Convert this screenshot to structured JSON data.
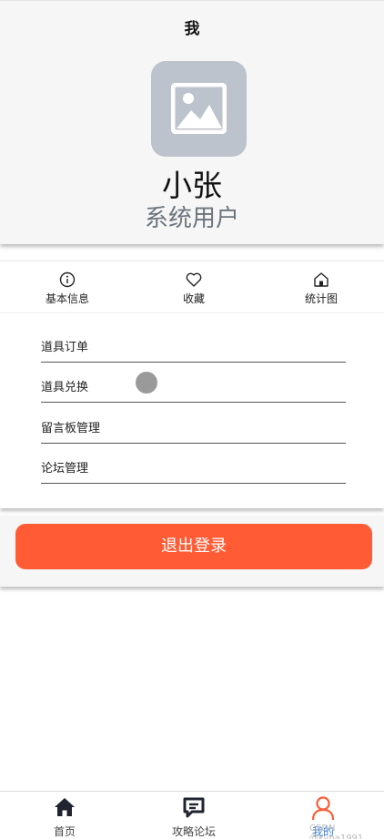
{
  "header": {
    "title": "我",
    "avatar_icon": "image-placeholder-icon",
    "user_name": "小张",
    "user_role": "系统用户"
  },
  "quick_links": [
    {
      "label": "基本信息",
      "icon": "info-circle-icon"
    },
    {
      "label": "收藏",
      "icon": "heart-icon"
    },
    {
      "label": "统计图",
      "icon": "home-icon"
    }
  ],
  "menu": [
    {
      "label": "道具订单"
    },
    {
      "label": "道具兑换"
    },
    {
      "label": "留言板管理"
    },
    {
      "label": "论坛管理"
    }
  ],
  "logout_label": "退出登录",
  "tabbar": [
    {
      "label": "首页",
      "icon": "home-filled-icon",
      "active": false
    },
    {
      "label": "攻略论坛",
      "icon": "chat-icon",
      "active": false
    },
    {
      "label": "我的",
      "icon": "user-icon",
      "active": true
    }
  ],
  "watermark": "CSDN @kyba1991",
  "colors": {
    "accent": "#ff5c35",
    "active_tab": "#3a7bd5",
    "avatar_bg": "#bcc3cc",
    "role_text": "#6c757d"
  }
}
